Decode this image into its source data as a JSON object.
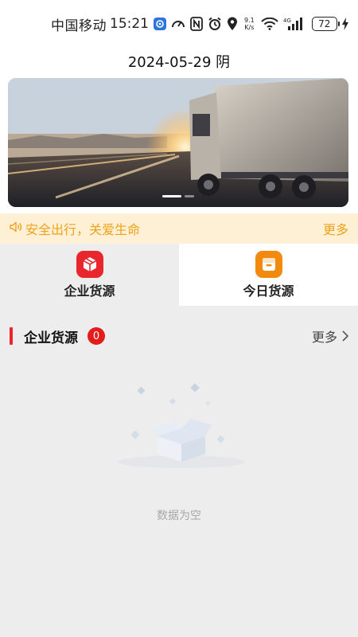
{
  "status_bar": {
    "carrier": "中国移动",
    "time": "15:21",
    "network_speed_value": "9.1",
    "network_speed_unit": "K/s",
    "signal_type": "4G",
    "battery": "72"
  },
  "header": {
    "date_weather": "2024-05-29 阴"
  },
  "notice": {
    "text": "安全出行，关爱生命",
    "more_label": "更多"
  },
  "tabs": [
    {
      "label": "企业货源",
      "icon": "box-icon",
      "color": "#e8262b"
    },
    {
      "label": "今日货源",
      "icon": "inbox-icon",
      "color": "#f28a10"
    }
  ],
  "section": {
    "title": "企业货源",
    "count": "0",
    "more_label": "更多"
  },
  "empty": {
    "text": "数据为空"
  },
  "colors": {
    "accent_red": "#e8262b",
    "notice_bg": "#fdf0d5",
    "notice_text": "#f0a21a",
    "orange": "#f28a10"
  }
}
